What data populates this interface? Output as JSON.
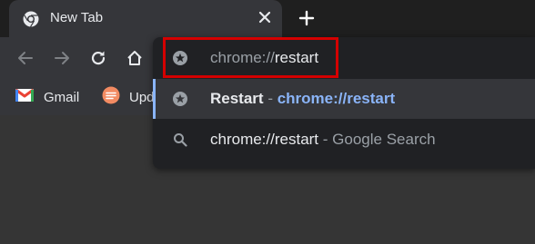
{
  "tab": {
    "title": "New Tab",
    "favicon": "chrome-icon",
    "close_icon": "close-icon"
  },
  "new_tab_icon": "plus-icon",
  "toolbar": {
    "back_icon": "arrow-left-icon",
    "forward_icon": "arrow-right-icon",
    "reload_icon": "reload-icon",
    "home_icon": "home-icon"
  },
  "bookmarks": [
    {
      "label": "Gmail",
      "icon": "gmail-icon"
    },
    {
      "label": "Upd",
      "icon": "updates-icon"
    }
  ],
  "omnibox": {
    "icon": "star-icon",
    "typed_prefix": "chrome://",
    "typed_suffix": "restart",
    "suggestions": [
      {
        "icon": "star-icon",
        "title": "Restart",
        "separator": " - ",
        "url": "chrome://restart",
        "selected": true
      },
      {
        "icon": "search-icon",
        "query": "chrome://restart",
        "separator": " - ",
        "provider": "Google Search",
        "selected": false
      }
    ]
  },
  "colors": {
    "highlight": "#d40000",
    "accent_link": "#8ab4f8"
  }
}
